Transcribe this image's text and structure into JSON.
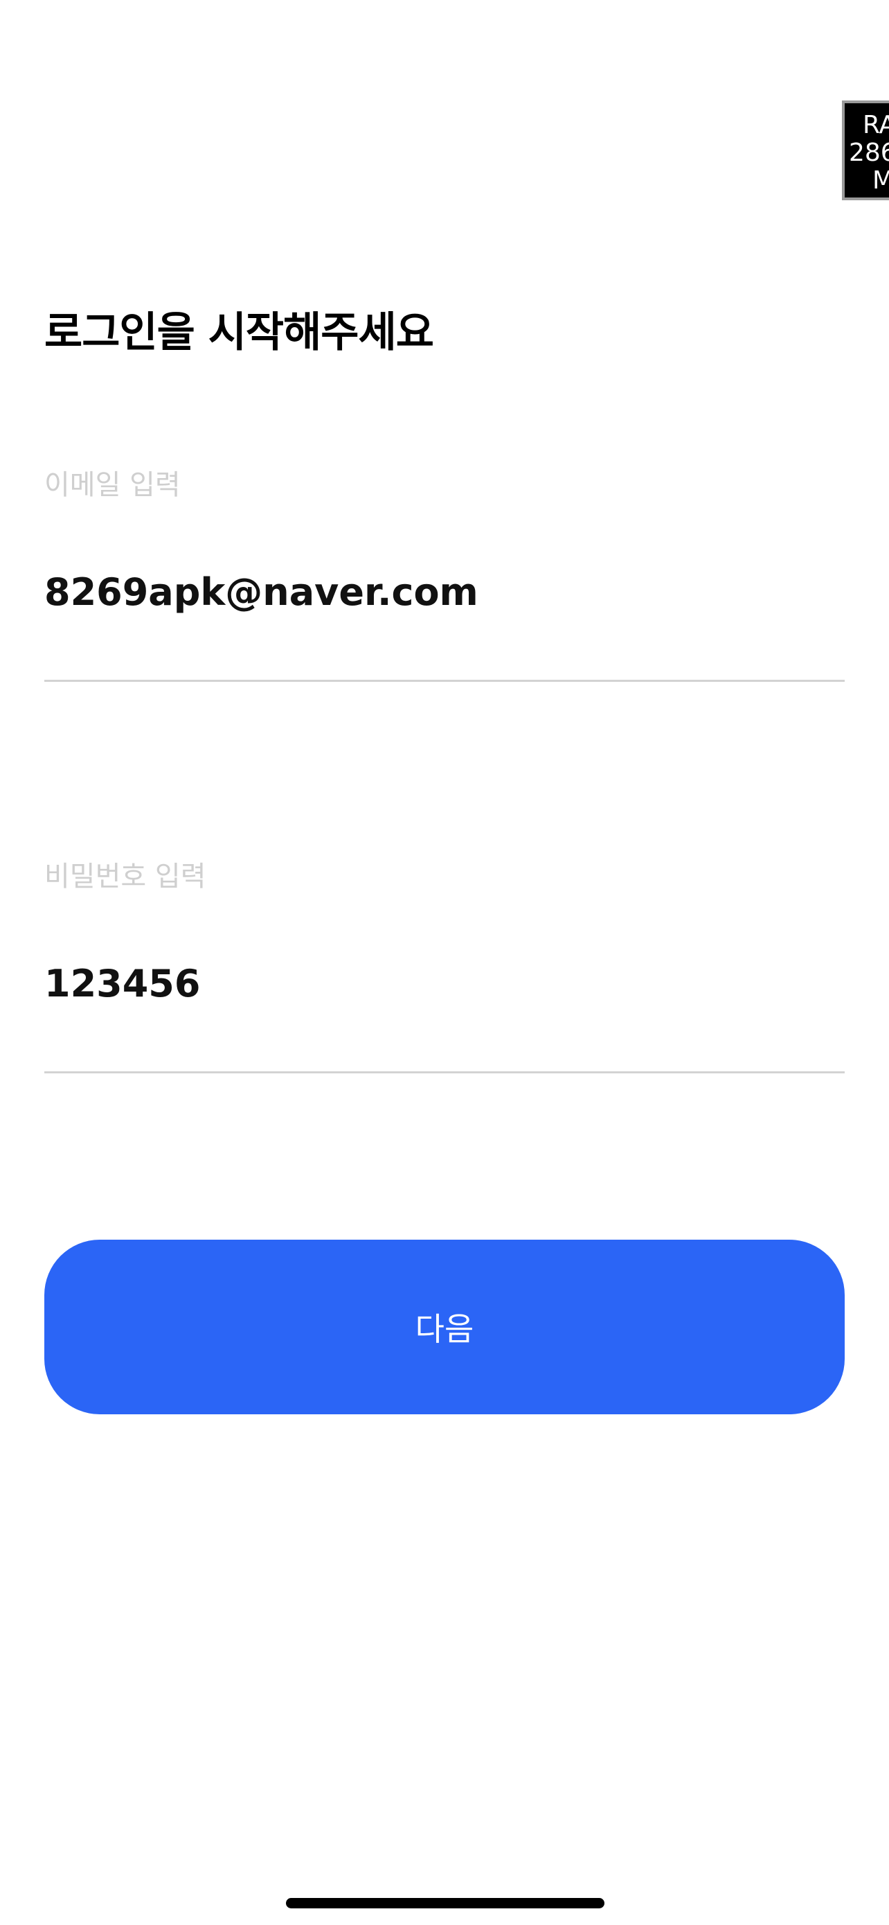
{
  "overlay_badge": {
    "line1": "RA",
    "line2": "286",
    "line3": "M"
  },
  "login": {
    "title": "로그인을 시작해주세요",
    "email": {
      "label": "이메일 입력",
      "value": "8269apk@naver.com"
    },
    "password": {
      "label": "비밀번호 입력",
      "value": "123456"
    },
    "next_label": "다음"
  },
  "colors": {
    "primary_button": "#2b65f6",
    "label_gray": "#cfcfcf",
    "underline": "#d3d3d3"
  }
}
